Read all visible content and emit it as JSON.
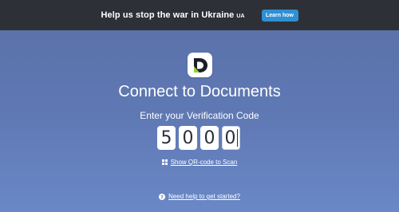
{
  "banner": {
    "text": "Help us stop the war in Ukraine",
    "country_code": "UA",
    "button_label": "Learn how"
  },
  "main": {
    "logo_icon": "documents-d-logo-icon",
    "title": "Connect to Documents",
    "subtitle": "Enter your Verification Code",
    "code_digits": [
      "5",
      "0",
      "0",
      "0"
    ],
    "qr_link_label": "Show QR-code to Scan",
    "qr_icon": "qr-grid-icon",
    "help_link_label": "Need help to get started?",
    "help_icon": "question-circle-icon"
  },
  "colors": {
    "banner_bg": "#2d3037",
    "banner_button": "#2f8fd3",
    "background_top": "#5a6fa6",
    "background_bottom": "#6a88c6",
    "logo_green": "#8fcf3a",
    "logo_dark": "#1c1f24"
  }
}
